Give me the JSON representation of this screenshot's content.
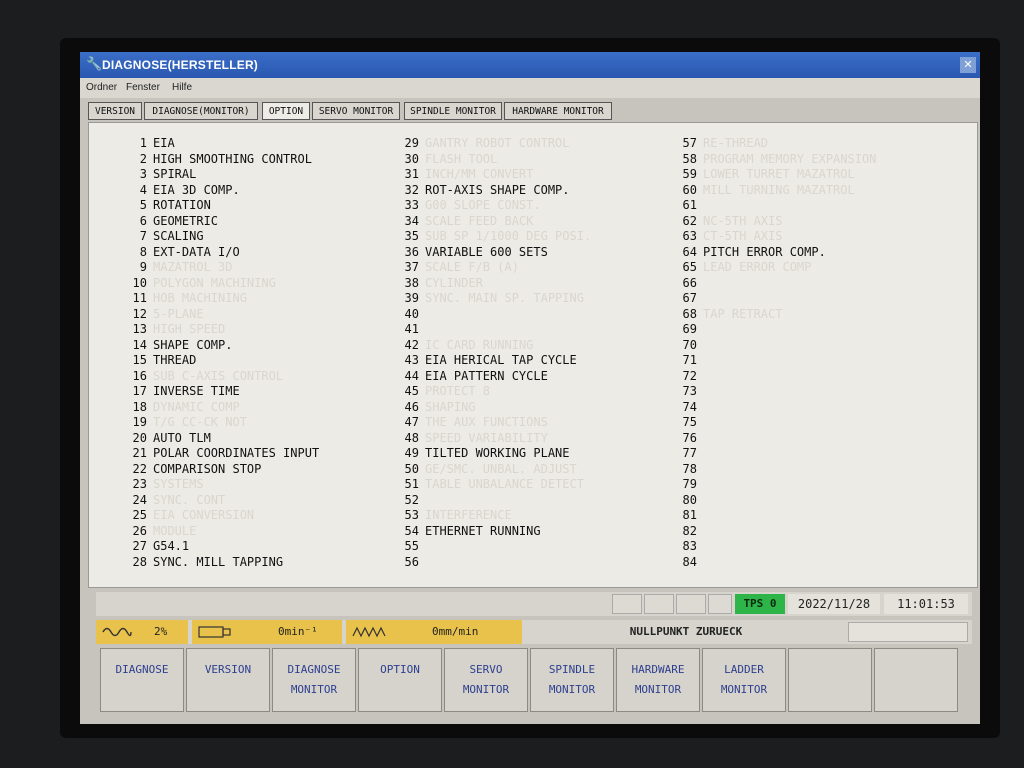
{
  "window": {
    "title": "DIAGNOSE(HERSTELLER)"
  },
  "menu": [
    "Ordner",
    "Fenster",
    "Hilfe"
  ],
  "tabs": [
    {
      "label": "VERSION",
      "active": false
    },
    {
      "label": "DIAGNOSE(MONITOR)",
      "active": false
    },
    {
      "label": "OPTION",
      "active": true
    },
    {
      "label": "SERVO MONITOR",
      "active": false
    },
    {
      "label": "SPINDLE MONITOR",
      "active": false
    },
    {
      "label": "HARDWARE MONITOR",
      "active": false
    }
  ],
  "options": {
    "col1": [
      {
        "n": "1",
        "label": "EIA",
        "on": true
      },
      {
        "n": "2",
        "label": "HIGH SMOOTHING CONTROL",
        "on": true
      },
      {
        "n": "3",
        "label": "SPIRAL",
        "on": true
      },
      {
        "n": "4",
        "label": "EIA 3D COMP.",
        "on": true
      },
      {
        "n": "5",
        "label": "ROTATION",
        "on": true
      },
      {
        "n": "6",
        "label": "GEOMETRIC",
        "on": true
      },
      {
        "n": "7",
        "label": "SCALING",
        "on": true
      },
      {
        "n": "8",
        "label": "EXT-DATA I/O",
        "on": true
      },
      {
        "n": "9",
        "label": "MAZATROL 3D",
        "on": false
      },
      {
        "n": "10",
        "label": "POLYGON MACHINING",
        "on": false
      },
      {
        "n": "11",
        "label": "HOB MACHINING",
        "on": false
      },
      {
        "n": "12",
        "label": "5-PLANE",
        "on": false
      },
      {
        "n": "13",
        "label": "HIGH SPEED",
        "on": false
      },
      {
        "n": "14",
        "label": "SHAPE COMP.",
        "on": true
      },
      {
        "n": "15",
        "label": "THREAD",
        "on": true
      },
      {
        "n": "16",
        "label": "SUB C-AXIS CONTROL",
        "on": false
      },
      {
        "n": "17",
        "label": "INVERSE TIME",
        "on": true
      },
      {
        "n": "18",
        "label": "DYNAMIC COMP",
        "on": false
      },
      {
        "n": "19",
        "label": "T/G CC-CK NOT",
        "on": false
      },
      {
        "n": "20",
        "label": "AUTO TLM",
        "on": true
      },
      {
        "n": "21",
        "label": "POLAR COORDINATES INPUT",
        "on": true
      },
      {
        "n": "22",
        "label": "COMPARISON STOP",
        "on": true
      },
      {
        "n": "23",
        "label": "SYSTEMS",
        "on": false
      },
      {
        "n": "24",
        "label": "SYNC. CONT",
        "on": false
      },
      {
        "n": "25",
        "label": "EIA CONVERSION",
        "on": false
      },
      {
        "n": "26",
        "label": "MODULE",
        "on": false
      },
      {
        "n": "27",
        "label": "G54.1",
        "on": true
      },
      {
        "n": "28",
        "label": "SYNC. MILL TAPPING",
        "on": true
      }
    ],
    "col2": [
      {
        "n": "29",
        "label": "GANTRY ROBOT CONTROL",
        "on": false
      },
      {
        "n": "30",
        "label": "FLASH TOOL",
        "on": false
      },
      {
        "n": "31",
        "label": "INCH/MM CONVERT",
        "on": false
      },
      {
        "n": "32",
        "label": "ROT-AXIS SHAPE COMP.",
        "on": true
      },
      {
        "n": "33",
        "label": "G00 SLOPE CONST.",
        "on": false
      },
      {
        "n": "34",
        "label": "SCALE FEED BACK",
        "on": false
      },
      {
        "n": "35",
        "label": "SUB SP 1/1000 DEG POSI.",
        "on": false
      },
      {
        "n": "36",
        "label": "VARIABLE 600 SETS",
        "on": true
      },
      {
        "n": "37",
        "label": "SCALE F/B (A)",
        "on": false
      },
      {
        "n": "38",
        "label": "CYLINDER",
        "on": false
      },
      {
        "n": "39",
        "label": "SYNC. MAIN SP. TAPPING",
        "on": false
      },
      {
        "n": "40",
        "label": "",
        "on": false
      },
      {
        "n": "41",
        "label": "",
        "on": false
      },
      {
        "n": "42",
        "label": "IC CARD RUNNING",
        "on": false
      },
      {
        "n": "43",
        "label": "EIA HERICAL TAP CYCLE",
        "on": true
      },
      {
        "n": "44",
        "label": "EIA PATTERN CYCLE",
        "on": true
      },
      {
        "n": "45",
        "label": "PROTECT 8",
        "on": false
      },
      {
        "n": "46",
        "label": "SHAPING",
        "on": false
      },
      {
        "n": "47",
        "label": "THE AUX FUNCTIONS",
        "on": false
      },
      {
        "n": "48",
        "label": "SPEED VARIABILITY",
        "on": false
      },
      {
        "n": "49",
        "label": "TILTED WORKING PLANE",
        "on": true
      },
      {
        "n": "50",
        "label": "GE/SMC. UNBAL. ADJUST",
        "on": false
      },
      {
        "n": "51",
        "label": "TABLE UNBALANCE DETECT",
        "on": false
      },
      {
        "n": "52",
        "label": "",
        "on": false
      },
      {
        "n": "53",
        "label": "INTERFERENCE",
        "on": false
      },
      {
        "n": "54",
        "label": "ETHERNET RUNNING",
        "on": true
      },
      {
        "n": "55",
        "label": "",
        "on": false
      },
      {
        "n": "56",
        "label": "",
        "on": false
      }
    ],
    "col3": [
      {
        "n": "57",
        "label": "RE-THREAD",
        "on": false
      },
      {
        "n": "58",
        "label": "PROGRAM MEMORY EXPANSION",
        "on": false
      },
      {
        "n": "59",
        "label": "LOWER TURRET MAZATROL",
        "on": false
      },
      {
        "n": "60",
        "label": "MILL TURNING MAZATROL",
        "on": false
      },
      {
        "n": "61",
        "label": "",
        "on": false
      },
      {
        "n": "62",
        "label": "NC-5TH AXIS",
        "on": false
      },
      {
        "n": "63",
        "label": "CT-5TH AXIS",
        "on": false
      },
      {
        "n": "64",
        "label": "PITCH ERROR COMP.",
        "on": true
      },
      {
        "n": "65",
        "label": "LEAD ERROR COMP",
        "on": false
      },
      {
        "n": "66",
        "label": "",
        "on": false
      },
      {
        "n": "67",
        "label": "",
        "on": false
      },
      {
        "n": "68",
        "label": "TAP RETRACT",
        "on": false
      },
      {
        "n": "69",
        "label": "",
        "on": false
      },
      {
        "n": "70",
        "label": "",
        "on": false
      },
      {
        "n": "71",
        "label": "",
        "on": false
      },
      {
        "n": "72",
        "label": "",
        "on": false
      },
      {
        "n": "73",
        "label": "",
        "on": false
      },
      {
        "n": "74",
        "label": "",
        "on": false
      },
      {
        "n": "75",
        "label": "",
        "on": false
      },
      {
        "n": "76",
        "label": "",
        "on": false
      },
      {
        "n": "77",
        "label": "",
        "on": false
      },
      {
        "n": "78",
        "label": "",
        "on": false
      },
      {
        "n": "79",
        "label": "",
        "on": false
      },
      {
        "n": "80",
        "label": "",
        "on": false
      },
      {
        "n": "81",
        "label": "",
        "on": false
      },
      {
        "n": "82",
        "label": "",
        "on": false
      },
      {
        "n": "83",
        "label": "",
        "on": false
      },
      {
        "n": "84",
        "label": "",
        "on": false
      }
    ]
  },
  "status": {
    "tps": "TPS 0",
    "date": "2022/11/28",
    "time": "11:01:53",
    "tps_color": "#2eb54a"
  },
  "load": {
    "spindle_load": "2%",
    "spindle_speed": "0min⁻¹",
    "feed": "0mm/min",
    "message": "NULLPUNKT ZURUECK",
    "highlight_color": "#e8c24a"
  },
  "softkeys": [
    {
      "l1": "DIAGNOSE",
      "l2": ""
    },
    {
      "l1": "VERSION",
      "l2": ""
    },
    {
      "l1": "DIAGNOSE",
      "l2": "MONITOR"
    },
    {
      "l1": "OPTION",
      "l2": ""
    },
    {
      "l1": "SERVO",
      "l2": "MONITOR"
    },
    {
      "l1": "SPINDLE",
      "l2": "MONITOR"
    },
    {
      "l1": "HARDWARE",
      "l2": "MONITOR"
    },
    {
      "l1": "LADDER",
      "l2": "MONITOR"
    },
    {
      "l1": "",
      "l2": ""
    },
    {
      "l1": "",
      "l2": ""
    }
  ]
}
